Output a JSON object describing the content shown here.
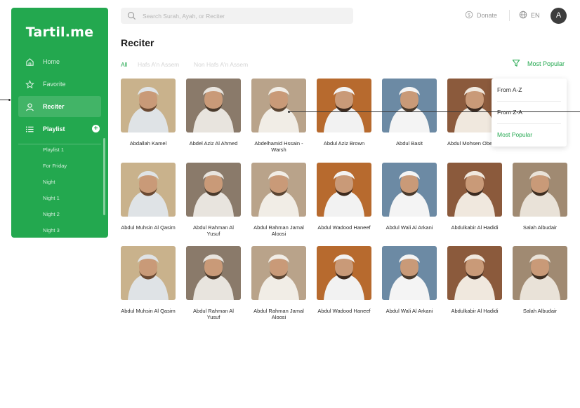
{
  "app": {
    "logo": "Tartil.me"
  },
  "sidebar": {
    "nav": [
      {
        "label": "Home",
        "icon": "home-icon"
      },
      {
        "label": "Favorite",
        "icon": "star-icon"
      },
      {
        "label": "Reciter",
        "icon": "user-icon"
      },
      {
        "label": "Playlist",
        "icon": "list-icon"
      }
    ],
    "active": "Reciter",
    "playlists": [
      "Playlist 1",
      "For Friday",
      "Night",
      "Night 1",
      "Night 2",
      "Night 3"
    ]
  },
  "header": {
    "search_placeholder": "Search Surah, Ayah, or Reciter",
    "donate_label": "Donate",
    "language": "EN",
    "avatar_initial": "A"
  },
  "main": {
    "title": "Reciter",
    "tabs": [
      "All",
      "Hafs A'n Assem",
      "Non Hafs A'n Assem"
    ],
    "active_tab": "All",
    "sort_label": "Most Popular",
    "sort_options": [
      "From A-Z",
      "From Z-A",
      "Most Popular"
    ],
    "sort_selected": "Most Popular",
    "reciters": [
      [
        "Abdallah Kamel",
        "Abdel Aziz Al Ahmed",
        "Abdelhamid Hssain - Warsh",
        "Abdul Aziz Brown",
        "Abdul Basit",
        "Abdul Mohsen Obeikan"
      ],
      [
        "Abdul Muhsin Al Qasim",
        "Abdul Rahman Al Yusuf",
        "Abdul Rahman Jamal Aloosi",
        "Abdul Wadood Haneef",
        "Abdul Wali Al Arkani",
        "Abdulkabir Al Hadidi",
        "Salah Albudair"
      ],
      [
        "Abdul Muhsin Al Qasim",
        "Abdul Rahman Al Yusuf",
        "Abdul Rahman Jamal Aloosi",
        "Abdul Wadood Haneef",
        "Abdul Wali Al Arkani",
        "Abdulkabir Al Hadidi",
        "Salah Albudair"
      ]
    ]
  },
  "colors": {
    "brand": "#23a84f",
    "sidebar_bg": "#23a84f"
  }
}
